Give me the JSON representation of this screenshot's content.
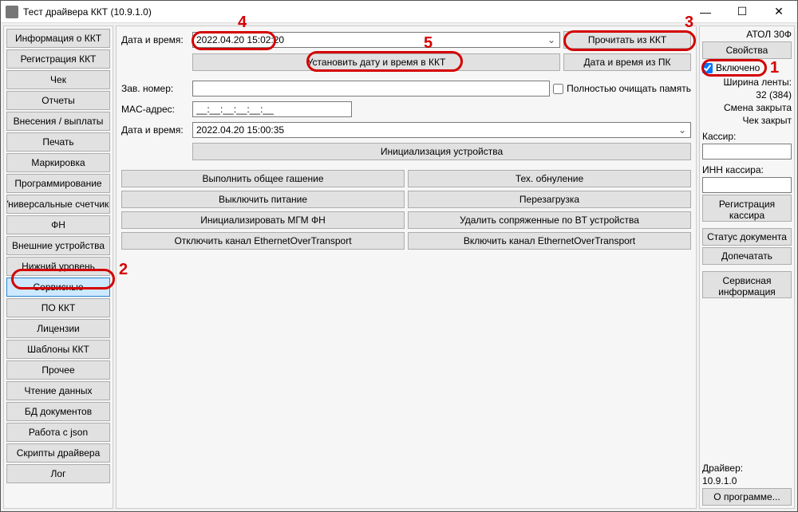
{
  "title": "Тест драйвера ККТ (10.9.1.0)",
  "window_controls": {
    "min": "—",
    "max": "☐",
    "close": "✕"
  },
  "nav": [
    "Информация о ККТ",
    "Регистрация ККТ",
    "Чек",
    "Отчеты",
    "Внесения / выплаты",
    "Печать",
    "Маркировка",
    "Программирование",
    "Универсальные счетчики",
    "ФН",
    "Внешние устройства",
    "Нижний уровень",
    "Сервисные",
    "ПО ККТ",
    "Лицензии",
    "Шаблоны ККТ",
    "Прочее",
    "Чтение данных",
    "БД документов",
    "Работа с json",
    "Скрипты драйвера",
    "Лог"
  ],
  "nav_active_index": 12,
  "center": {
    "labels": {
      "datetime": "Дата и время:",
      "zav": "Зав. номер:",
      "mac": "MAC-адрес:",
      "datetime2": "Дата и время:"
    },
    "datetime_value": "2022.04.20 15:02:20",
    "read_from_kkt": "Прочитать из ККТ",
    "set_datetime_kkt": "Установить дату и время в ККТ",
    "datetime_from_pc": "Дата и время из ПК",
    "zav_value": "",
    "full_clear_mem": "Полностью очищать память",
    "mac_value": "__:__:__:__:__:__",
    "datetime2_value": "2022.04.20 15:00:35",
    "init_device": "Инициализация устройства",
    "buttons_grid": [
      [
        "Выполнить общее гашение",
        "Тех. обнуление"
      ],
      [
        "Выключить питание",
        "Перезагрузка"
      ],
      [
        "Инициализировать МГМ ФН",
        "Удалить сопряженные по BT устройства"
      ],
      [
        "Отключить канал EthernetOverTransport",
        "Включить канал EthernetOverTransport"
      ]
    ]
  },
  "right": {
    "model": "АТОЛ 30Ф",
    "properties_btn": "Свойства",
    "enabled_label": "Включено",
    "enabled_checked": true,
    "tape_width_label": "Ширина ленты:",
    "tape_width_value": "32 (384)",
    "shift_closed": "Смена закрыта",
    "check_closed": "Чек закрыт",
    "cashier_label": "Кассир:",
    "cashier_value": "",
    "inn_label": "ИНН кассира:",
    "inn_value": "",
    "reg_cashier": "Регистрация кассира",
    "doc_status": "Статус документа",
    "reprint": "Допечатать",
    "service_info": "Сервисная информация",
    "driver_label": "Драйвер:",
    "driver_version": "10.9.1.0",
    "about": "О программе..."
  },
  "annotations": {
    "n1": "1",
    "n2": "2",
    "n3": "3",
    "n4": "4",
    "n5": "5"
  }
}
